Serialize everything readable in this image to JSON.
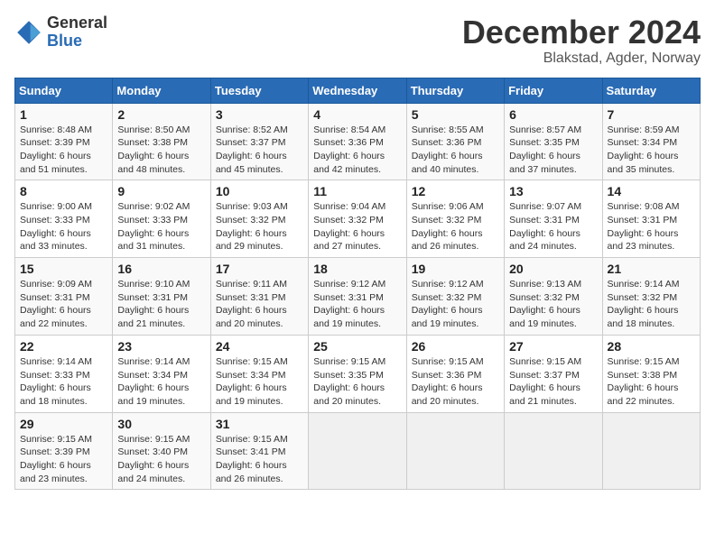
{
  "header": {
    "logo_general": "General",
    "logo_blue": "Blue",
    "month_title": "December 2024",
    "location": "Blakstad, Agder, Norway"
  },
  "days_of_week": [
    "Sunday",
    "Monday",
    "Tuesday",
    "Wednesday",
    "Thursday",
    "Friday",
    "Saturday"
  ],
  "weeks": [
    [
      {
        "day": "1",
        "info": "Sunrise: 8:48 AM\nSunset: 3:39 PM\nDaylight: 6 hours\nand 51 minutes."
      },
      {
        "day": "2",
        "info": "Sunrise: 8:50 AM\nSunset: 3:38 PM\nDaylight: 6 hours\nand 48 minutes."
      },
      {
        "day": "3",
        "info": "Sunrise: 8:52 AM\nSunset: 3:37 PM\nDaylight: 6 hours\nand 45 minutes."
      },
      {
        "day": "4",
        "info": "Sunrise: 8:54 AM\nSunset: 3:36 PM\nDaylight: 6 hours\nand 42 minutes."
      },
      {
        "day": "5",
        "info": "Sunrise: 8:55 AM\nSunset: 3:36 PM\nDaylight: 6 hours\nand 40 minutes."
      },
      {
        "day": "6",
        "info": "Sunrise: 8:57 AM\nSunset: 3:35 PM\nDaylight: 6 hours\nand 37 minutes."
      },
      {
        "day": "7",
        "info": "Sunrise: 8:59 AM\nSunset: 3:34 PM\nDaylight: 6 hours\nand 35 minutes."
      }
    ],
    [
      {
        "day": "8",
        "info": "Sunrise: 9:00 AM\nSunset: 3:33 PM\nDaylight: 6 hours\nand 33 minutes."
      },
      {
        "day": "9",
        "info": "Sunrise: 9:02 AM\nSunset: 3:33 PM\nDaylight: 6 hours\nand 31 minutes."
      },
      {
        "day": "10",
        "info": "Sunrise: 9:03 AM\nSunset: 3:32 PM\nDaylight: 6 hours\nand 29 minutes."
      },
      {
        "day": "11",
        "info": "Sunrise: 9:04 AM\nSunset: 3:32 PM\nDaylight: 6 hours\nand 27 minutes."
      },
      {
        "day": "12",
        "info": "Sunrise: 9:06 AM\nSunset: 3:32 PM\nDaylight: 6 hours\nand 26 minutes."
      },
      {
        "day": "13",
        "info": "Sunrise: 9:07 AM\nSunset: 3:31 PM\nDaylight: 6 hours\nand 24 minutes."
      },
      {
        "day": "14",
        "info": "Sunrise: 9:08 AM\nSunset: 3:31 PM\nDaylight: 6 hours\nand 23 minutes."
      }
    ],
    [
      {
        "day": "15",
        "info": "Sunrise: 9:09 AM\nSunset: 3:31 PM\nDaylight: 6 hours\nand 22 minutes."
      },
      {
        "day": "16",
        "info": "Sunrise: 9:10 AM\nSunset: 3:31 PM\nDaylight: 6 hours\nand 21 minutes."
      },
      {
        "day": "17",
        "info": "Sunrise: 9:11 AM\nSunset: 3:31 PM\nDaylight: 6 hours\nand 20 minutes."
      },
      {
        "day": "18",
        "info": "Sunrise: 9:12 AM\nSunset: 3:31 PM\nDaylight: 6 hours\nand 19 minutes."
      },
      {
        "day": "19",
        "info": "Sunrise: 9:12 AM\nSunset: 3:32 PM\nDaylight: 6 hours\nand 19 minutes."
      },
      {
        "day": "20",
        "info": "Sunrise: 9:13 AM\nSunset: 3:32 PM\nDaylight: 6 hours\nand 19 minutes."
      },
      {
        "day": "21",
        "info": "Sunrise: 9:14 AM\nSunset: 3:32 PM\nDaylight: 6 hours\nand 18 minutes."
      }
    ],
    [
      {
        "day": "22",
        "info": "Sunrise: 9:14 AM\nSunset: 3:33 PM\nDaylight: 6 hours\nand 18 minutes."
      },
      {
        "day": "23",
        "info": "Sunrise: 9:14 AM\nSunset: 3:34 PM\nDaylight: 6 hours\nand 19 minutes."
      },
      {
        "day": "24",
        "info": "Sunrise: 9:15 AM\nSunset: 3:34 PM\nDaylight: 6 hours\nand 19 minutes."
      },
      {
        "day": "25",
        "info": "Sunrise: 9:15 AM\nSunset: 3:35 PM\nDaylight: 6 hours\nand 20 minutes."
      },
      {
        "day": "26",
        "info": "Sunrise: 9:15 AM\nSunset: 3:36 PM\nDaylight: 6 hours\nand 20 minutes."
      },
      {
        "day": "27",
        "info": "Sunrise: 9:15 AM\nSunset: 3:37 PM\nDaylight: 6 hours\nand 21 minutes."
      },
      {
        "day": "28",
        "info": "Sunrise: 9:15 AM\nSunset: 3:38 PM\nDaylight: 6 hours\nand 22 minutes."
      }
    ],
    [
      {
        "day": "29",
        "info": "Sunrise: 9:15 AM\nSunset: 3:39 PM\nDaylight: 6 hours\nand 23 minutes."
      },
      {
        "day": "30",
        "info": "Sunrise: 9:15 AM\nSunset: 3:40 PM\nDaylight: 6 hours\nand 24 minutes."
      },
      {
        "day": "31",
        "info": "Sunrise: 9:15 AM\nSunset: 3:41 PM\nDaylight: 6 hours\nand 26 minutes."
      },
      {
        "day": "",
        "info": ""
      },
      {
        "day": "",
        "info": ""
      },
      {
        "day": "",
        "info": ""
      },
      {
        "day": "",
        "info": ""
      }
    ]
  ]
}
